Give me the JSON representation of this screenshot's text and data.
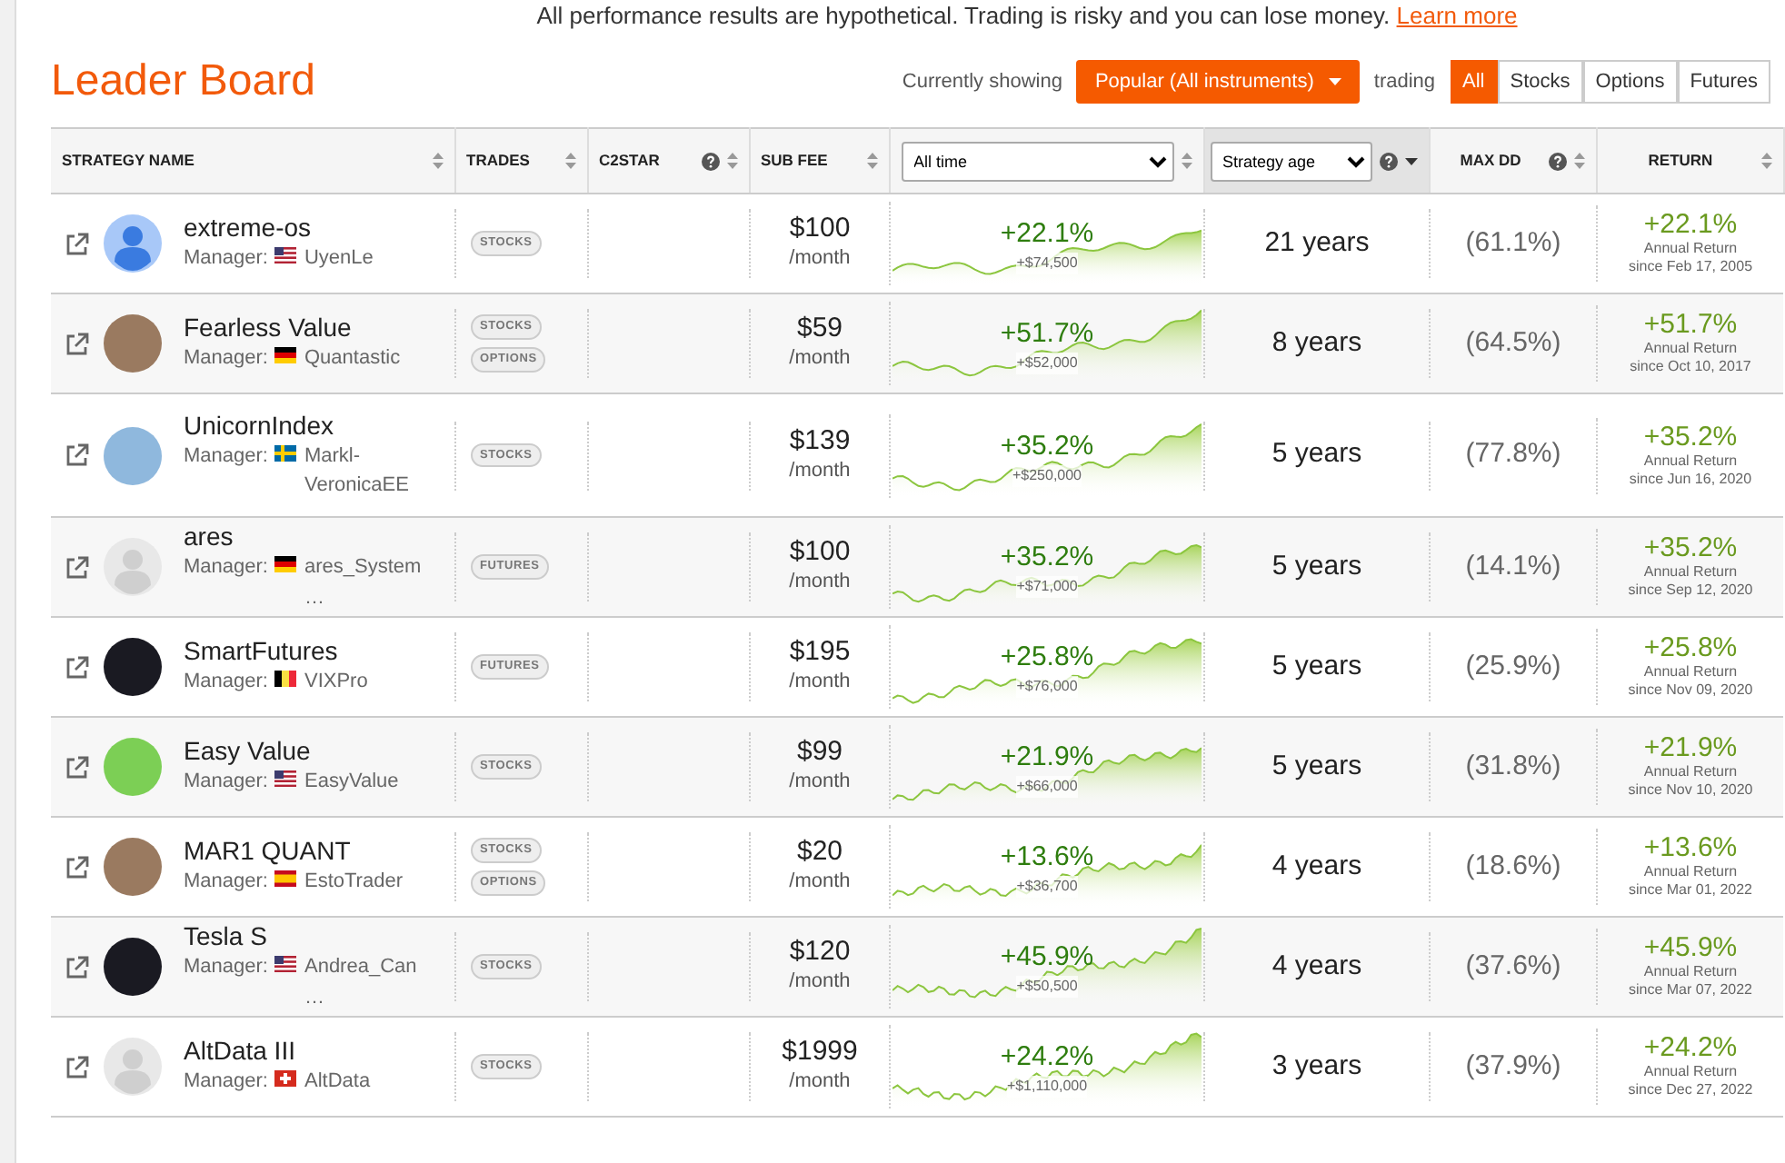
{
  "banner": {
    "text": "All performance results are hypothetical. Trading is risky and you can lose money.",
    "link": "Learn more"
  },
  "title": "Leader Board",
  "filter": {
    "showing_label": "Currently showing",
    "dropdown": "Popular (All instruments)",
    "trading_label": "trading",
    "options": [
      {
        "label": "All",
        "selected": true
      },
      {
        "label": "Stocks",
        "selected": false
      },
      {
        "label": "Options",
        "selected": false
      },
      {
        "label": "Futures",
        "selected": false
      }
    ]
  },
  "table": {
    "columns": [
      {
        "kind": "label",
        "label": "STRATEGY NAME",
        "help": false,
        "sorted": false
      },
      {
        "kind": "label",
        "label": "TRADES",
        "help": false,
        "sorted": false
      },
      {
        "kind": "label",
        "label": "C2STAR",
        "help": true,
        "sorted": false
      },
      {
        "kind": "label",
        "label": "SUB FEE",
        "help": false,
        "sorted": false
      },
      {
        "kind": "select",
        "value": "All time",
        "help": false,
        "sorted": false
      },
      {
        "kind": "select",
        "value": "Strategy age",
        "help": true,
        "sorted": true
      },
      {
        "kind": "label",
        "label": "MAX DD",
        "help": true,
        "sorted": false
      },
      {
        "kind": "label",
        "label": "RETURN",
        "help": false,
        "sorted": false
      }
    ],
    "rows": [
      {
        "name": "extreme-os",
        "manager_label": "Manager:",
        "manager": "UyenLe",
        "flag": {
          "kind": "us"
        },
        "avatar": {
          "kind": "user-blue"
        },
        "tags": [
          "STOCKS"
        ],
        "fee": "$100",
        "fee_unit": "/month",
        "pct": "+22.1%",
        "gain": "+$74,500",
        "age": "21 years",
        "max_dd": "(61.1%)",
        "return": "+22.1%",
        "return_label": "Annual Return",
        "since": "since Feb 17, 2005"
      },
      {
        "name": "Fearless Value",
        "manager_label": "Manager:",
        "manager": "Quantastic",
        "flag": {
          "kind": "de"
        },
        "avatar": {
          "kind": "photo"
        },
        "tags": [
          "STOCKS",
          "OPTIONS"
        ],
        "fee": "$59",
        "fee_unit": "/month",
        "pct": "+51.7%",
        "gain": "+$52,000",
        "age": "8 years",
        "max_dd": "(64.5%)",
        "return": "+51.7%",
        "return_label": "Annual Return",
        "since": "since Oct 10, 2017"
      },
      {
        "name": "UnicornIndex",
        "manager_label": "Manager:",
        "manager": "Markl-VeronicaEE",
        "flag": {
          "kind": "se"
        },
        "avatar": {
          "kind": "photo-blue"
        },
        "tags": [
          "STOCKS"
        ],
        "fee": "$139",
        "fee_unit": "/month",
        "pct": "+35.2%",
        "gain": "+$250,000",
        "age": "5 years",
        "max_dd": "(77.8%)",
        "return": "+35.2%",
        "return_label": "Annual Return",
        "since": "since Jun 16, 2020"
      },
      {
        "name": "ares",
        "manager_label": "Manager:",
        "manager": "ares_System…",
        "flag": {
          "kind": "de"
        },
        "avatar": {
          "kind": "user-grey"
        },
        "tags": [
          "FUTURES"
        ],
        "fee": "$100",
        "fee_unit": "/month",
        "pct": "+35.2%",
        "gain": "+$71,000",
        "age": "5 years",
        "max_dd": "(14.1%)",
        "return": "+35.2%",
        "return_label": "Annual Return",
        "since": "since Sep 12, 2020"
      },
      {
        "name": "SmartFutures",
        "manager_label": "Manager:",
        "manager": "VIXPro",
        "flag": {
          "kind": "be"
        },
        "avatar": {
          "kind": "logo-dark"
        },
        "tags": [
          "FUTURES"
        ],
        "fee": "$195",
        "fee_unit": "/month",
        "pct": "+25.8%",
        "gain": "+$76,000",
        "age": "5 years",
        "max_dd": "(25.9%)",
        "return": "+25.8%",
        "return_label": "Annual Return",
        "since": "since Nov 09, 2020"
      },
      {
        "name": "Easy Value",
        "manager_label": "Manager:",
        "manager": "EasyValue",
        "flag": {
          "kind": "us"
        },
        "avatar": {
          "kind": "logo-green"
        },
        "tags": [
          "STOCKS"
        ],
        "fee": "$99",
        "fee_unit": "/month",
        "pct": "+21.9%",
        "gain": "+$66,000",
        "age": "5 years",
        "max_dd": "(31.8%)",
        "return": "+21.9%",
        "return_label": "Annual Return",
        "since": "since Nov 10, 2020"
      },
      {
        "name": "MAR1 QUANT",
        "manager_label": "Manager:",
        "manager": "EstoTrader",
        "flag": {
          "kind": "es"
        },
        "avatar": {
          "kind": "photo"
        },
        "tags": [
          "STOCKS",
          "OPTIONS"
        ],
        "fee": "$20",
        "fee_unit": "/month",
        "pct": "+13.6%",
        "gain": "+$36,700",
        "age": "4 years",
        "max_dd": "(18.6%)",
        "return": "+13.6%",
        "return_label": "Annual Return",
        "since": "since Mar 01, 2022"
      },
      {
        "name": "Tesla S",
        "manager_label": "Manager:",
        "manager": "Andrea_Can…",
        "flag": {
          "kind": "us"
        },
        "avatar": {
          "kind": "logo-dark"
        },
        "tags": [
          "STOCKS"
        ],
        "fee": "$120",
        "fee_unit": "/month",
        "pct": "+45.9%",
        "gain": "+$50,500",
        "age": "4 years",
        "max_dd": "(37.6%)",
        "return": "+45.9%",
        "return_label": "Annual Return",
        "since": "since Mar 07, 2022"
      },
      {
        "name": "AltData III",
        "manager_label": "Manager:",
        "manager": "AltData",
        "flag": {
          "kind": "ch"
        },
        "avatar": {
          "kind": "user-grey"
        },
        "tags": [
          "STOCKS"
        ],
        "fee": "$1999",
        "fee_unit": "/month",
        "pct": "+24.2%",
        "gain": "+$1,110,000",
        "age": "3 years",
        "max_dd": "(37.9%)",
        "return": "+24.2%",
        "return_label": "Annual Return",
        "since": "since Dec 27, 2022"
      }
    ]
  }
}
